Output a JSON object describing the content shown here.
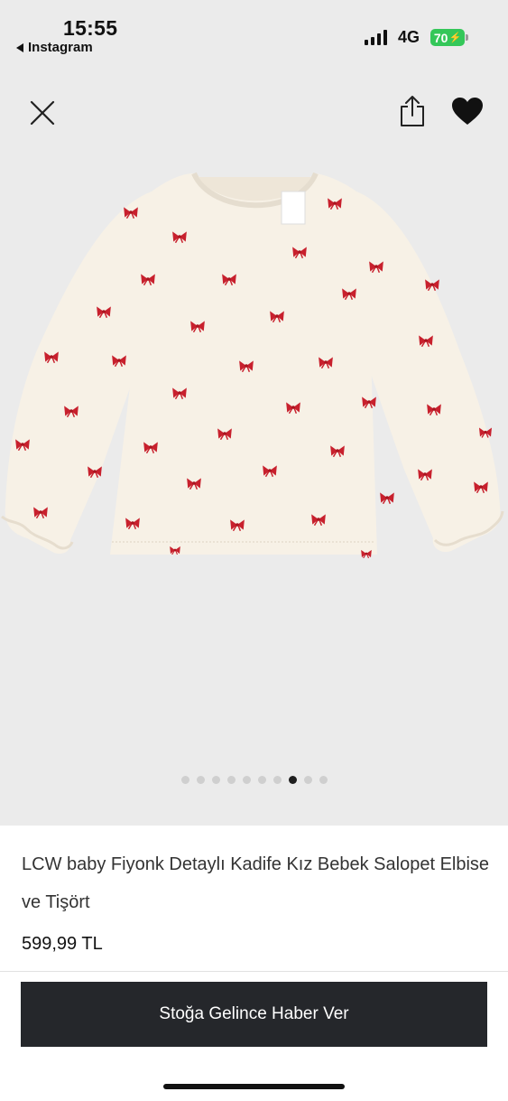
{
  "status_bar": {
    "time": "15:55",
    "back_app": "Instagram",
    "network": "4G",
    "battery": "70"
  },
  "actions": {
    "close_icon": "close-icon",
    "share_icon": "share-icon",
    "favorite_icon": "heart-icon"
  },
  "gallery": {
    "image": "product-photo-long-sleeve-bow-print-top",
    "dot_count": 10,
    "active_index": 7
  },
  "product": {
    "title": "LCW baby Fiyonk Detaylı Kadife Kız Bebek Salopet Elbise ve Tişört",
    "price": "599,99 TL"
  },
  "cta": {
    "label": "Stoğa Gelince Haber Ver"
  },
  "colors": {
    "background_media": "#ebebeb",
    "cta_background": "#25272b",
    "battery": "#34c759",
    "bow_red": "#c8202d",
    "fabric": "#f7f1e6"
  }
}
